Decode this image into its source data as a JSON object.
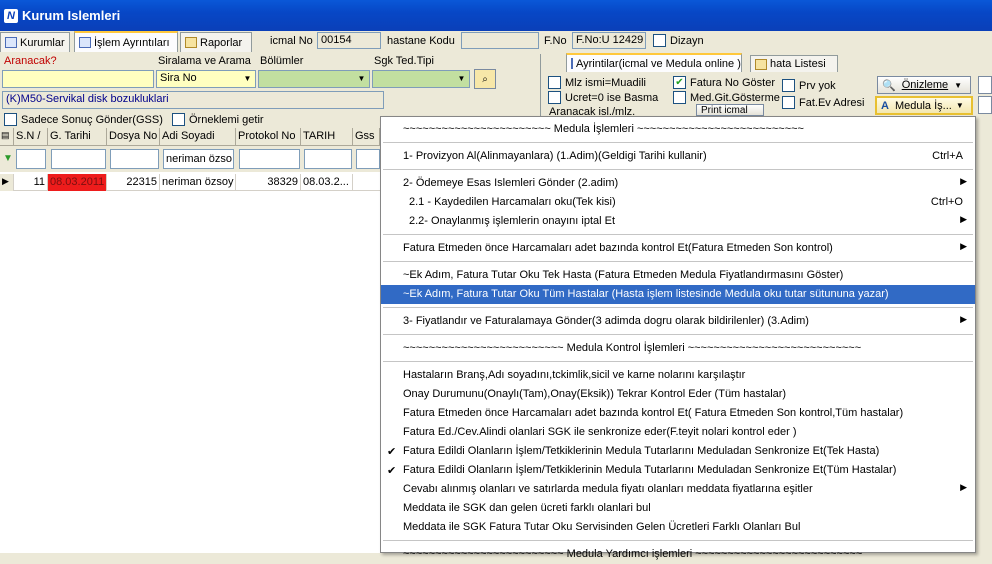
{
  "window": {
    "title": "Kurum Islemleri",
    "icon": "app-logo-icon"
  },
  "tabs": [
    {
      "label": "Kurumlar"
    },
    {
      "label": "İşlem Ayrıntıları"
    },
    {
      "label": "Raporlar"
    }
  ],
  "header": {
    "icmal_label": "icmal No",
    "icmal_value": "00154",
    "hastane_label": "hastane Kodu",
    "hastane_value": "",
    "fno_label": "F.No",
    "fno_value": "F.No:U 12429",
    "dizayn_label": "Dizayn"
  },
  "search": {
    "aranacak_label": "Aranacak?",
    "aranacak_value": "",
    "siralama_label": "Siralama ve Arama",
    "siralama_value": "Sira No",
    "bolumler_label": "Bölümler",
    "bolumler_value": "",
    "sgk_label": "Sgk Ted.Tipi",
    "sgk_value": "",
    "diagnosis": "(K)M50-Servikal disk bozukluklari",
    "sadece_label": "Sadece Sonuç Gönder(GSS)",
    "ornek_label": "Örneklemi getir"
  },
  "right_tabs": [
    {
      "label": "Ayrintilar(icmal ve Medula online )"
    },
    {
      "label": "hata Listesi"
    }
  ],
  "options": {
    "mlz": "Mlz ismi=Muadili",
    "ucret": "Ucret=0 ise Basma",
    "fatura_no": "Fatura No Göster",
    "med_git": "Med.Git.Gösterme",
    "prv_yok": "Prv yok",
    "fat_ev": "Fat.Ev Adresi",
    "aranacak_isl": "Aranacak isl./mlz.",
    "print_icmal": "Print icmal",
    "onizleme": "Önizleme",
    "medula_is": "Medula İş..."
  },
  "grid": {
    "headers": [
      "S.N /",
      "G. Tarihi",
      "Dosya No",
      "Adi Soyadi",
      "Protokol No",
      "TARIH",
      "Gss"
    ],
    "filter_name": "neriman özso",
    "rows": [
      {
        "sn": "11",
        "gtarihi": "08.03.2011",
        "dosya": "22315",
        "adi": "neriman özsoy",
        "protokol": "38329",
        "tarih": "08.03.2..."
      }
    ]
  },
  "menu": {
    "items": [
      {
        "label": "~~~~~~~~~~~~~~~~~~~~~~~ Medula İşlemleri ~~~~~~~~~~~~~~~~~~~~~~~~~~",
        "shortcut": "",
        "submenu": false,
        "checked": false,
        "highlight": false
      },
      {
        "label": "1- Provizyon Al(Alinmayanlara) (1.Adim)(Geldigi Tarihi kullanir)",
        "shortcut": "Ctrl+A",
        "submenu": false,
        "checked": false,
        "highlight": false
      },
      {
        "label": "2- Ödemeye Esas Islemleri Gönder (2.adim)",
        "shortcut": "",
        "submenu": true,
        "checked": false,
        "highlight": false
      },
      {
        "label": "2.1 -   Kaydedilen Harcamaları oku(Tek kisi)",
        "shortcut": "Ctrl+O",
        "submenu": false,
        "checked": false,
        "highlight": false
      },
      {
        "label": "2.2-   Onaylanmış işlemlerin onayını iptal Et",
        "shortcut": "",
        "submenu": true,
        "checked": false,
        "highlight": false
      },
      {
        "label": "Fatura Etmeden önce Harcamaları adet bazında kontrol Et(Fatura Etmeden Son kontrol)",
        "shortcut": "",
        "submenu": true,
        "checked": false,
        "highlight": false
      },
      {
        "label": "~Ek Adım, Fatura Tutar Oku Tek Hasta (Fatura Etmeden Medula Fiyatlandırmasını Göster)",
        "shortcut": "",
        "submenu": false,
        "checked": false,
        "highlight": false
      },
      {
        "label": "~Ek Adım, Fatura Tutar Oku Tüm Hastalar (Hasta işlem listesinde Medula oku tutar sütununa yazar)",
        "shortcut": "",
        "submenu": false,
        "checked": false,
        "highlight": true
      },
      {
        "label": "3- Fiyatlandır ve Faturalamaya Gönder(3 adimda dogru olarak bildirilenler) (3.Adim)",
        "shortcut": "",
        "submenu": true,
        "checked": false,
        "highlight": false
      },
      {
        "label": "~~~~~~~~~~~~~~~~~~~~~~~~~  Medula Kontrol İşlemleri  ~~~~~~~~~~~~~~~~~~~~~~~~~~~",
        "shortcut": "",
        "submenu": false,
        "checked": false,
        "highlight": false
      },
      {
        "label": "Hastaların Branş,Adı soyadını,tckimlik,sicil ve karne nolarını karşılaştır",
        "shortcut": "",
        "submenu": false,
        "checked": false,
        "highlight": false
      },
      {
        "label": "Onay Durumunu(Onaylı(Tam),Onay(Eksik))  Tekrar Kontrol Eder (Tüm hastalar)",
        "shortcut": "",
        "submenu": false,
        "checked": false,
        "highlight": false
      },
      {
        "label": "Fatura Etmeden önce Harcamaları adet bazında kontrol Et( Fatura Etmeden Son kontrol,Tüm hastalar)",
        "shortcut": "",
        "submenu": false,
        "checked": false,
        "highlight": false
      },
      {
        "label": "Fatura Ed./Cev.Alindi olanlari SGK ile senkronize eder(F.teyit nolari kontrol eder )",
        "shortcut": "",
        "submenu": false,
        "checked": false,
        "highlight": false
      },
      {
        "label": "Fatura Edildi Olanların İşlem/Tetkiklerinin Medula Tutarlarını Meduladan Senkronize Et(Tek Hasta)",
        "shortcut": "",
        "submenu": false,
        "checked": true,
        "highlight": false
      },
      {
        "label": "Fatura Edildi Olanların İşlem/Tetkiklerinin Medula Tutarlarını Meduladan Senkronize Et(Tüm Hastalar)",
        "shortcut": "",
        "submenu": false,
        "checked": true,
        "highlight": false
      },
      {
        "label": "Cevabı alınmış olanları ve satırlarda medula fiyatı olanları meddata fiyatlarına eşitler",
        "shortcut": "",
        "submenu": true,
        "checked": false,
        "highlight": false
      },
      {
        "label": "Meddata ile SGK dan gelen ücreti farklı olanlari bul",
        "shortcut": "",
        "submenu": false,
        "checked": false,
        "highlight": false
      },
      {
        "label": "Meddata ile SGK Fatura Tutar Oku Servisinden Gelen Ücretleri Farklı Olanları Bul",
        "shortcut": "",
        "submenu": false,
        "checked": false,
        "highlight": false
      },
      {
        "label": "~~~~~~~~~~~~~~~~~~~~~~~~~  Medula Yardımcı işlemleri  ~~~~~~~~~~~~~~~~~~~~~~~~~~",
        "shortcut": "",
        "submenu": false,
        "checked": false,
        "highlight": false
      }
    ]
  }
}
